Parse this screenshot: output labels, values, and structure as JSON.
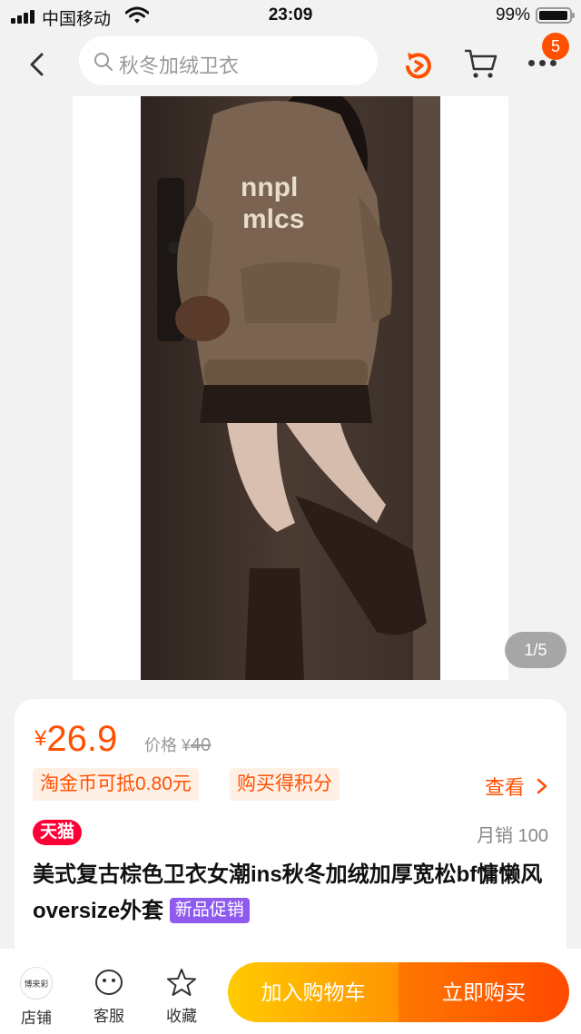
{
  "status_bar": {
    "carrier": "中国移动",
    "time": "23:09",
    "battery_percent": "99%",
    "battery_level": 0.99
  },
  "nav": {
    "search_placeholder": "秋冬加绒卫衣",
    "cart_badge": "5",
    "icons": [
      "back-icon",
      "search-icon",
      "refresh-icon",
      "cart-icon",
      "more-icon"
    ]
  },
  "gallery": {
    "counter": "1/5"
  },
  "product": {
    "currency": "¥",
    "price": "26.9",
    "original_label": "价格",
    "original_currency": "¥",
    "original_price": "40",
    "coin_tag": "淘金币可抵0.80元",
    "points_tag": "购买得积分",
    "view_label": "查看",
    "store_badge": "天猫",
    "monthly_sales": "月销 100",
    "title": "美式复古棕色卫衣女潮ins秋冬加绒加厚宽松bf慵懒风oversize外套",
    "promo_tag": "新品促销"
  },
  "bottom_bar": {
    "shop_logo_text": "博来彩",
    "shop_label": "店铺",
    "service_label": "客服",
    "favorite_label": "收藏",
    "add_to_cart": "加入购物车",
    "buy_now": "立即购买"
  },
  "colors": {
    "accent": "#ff5000",
    "tmall_red": "#ff0036",
    "promo_purple": "#8f5af0"
  }
}
